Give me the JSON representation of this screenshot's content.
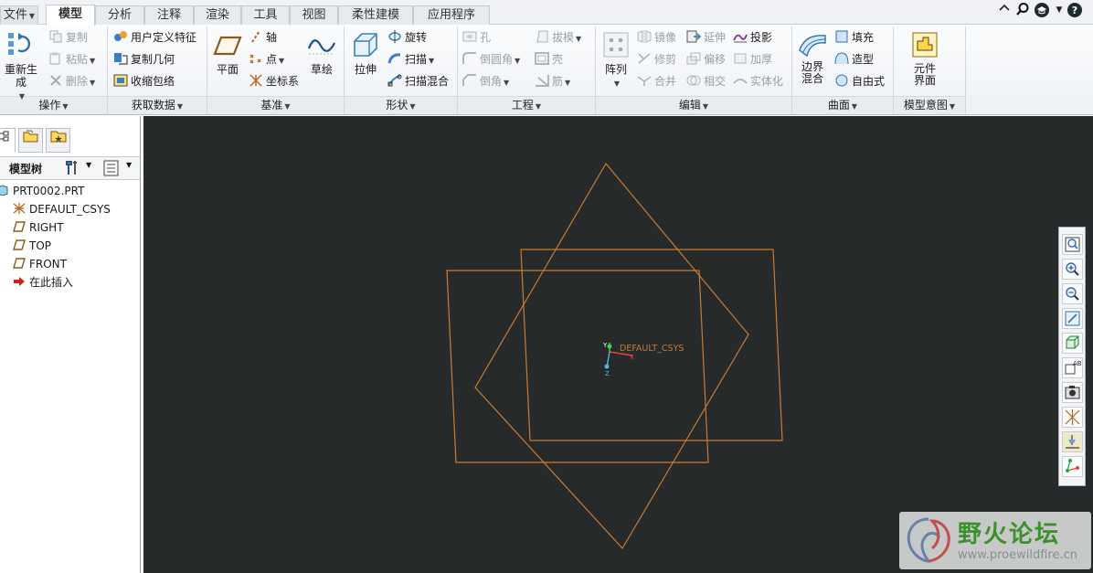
{
  "tabs": {
    "file": "文件",
    "items": [
      "模型",
      "分析",
      "注释",
      "渲染",
      "工具",
      "视图",
      "柔性建模",
      "应用程序"
    ],
    "active_index": 0
  },
  "ribbon": {
    "groups": {
      "operations": {
        "label": "操作",
        "regenerate": "重新生成",
        "copy": "复制",
        "paste": "粘贴",
        "delete": "删除"
      },
      "get_data": {
        "label": "获取数据",
        "udf": "用户定义特征",
        "copy_geom": "复制几何",
        "shrinkwrap": "收缩包络"
      },
      "datum": {
        "label": "基准",
        "plane": "平面",
        "axis": "轴",
        "point": "点",
        "csys": "坐标系",
        "sketch": "草绘"
      },
      "shapes": {
        "label": "形状",
        "extrude": "拉伸",
        "revolve": "旋转",
        "sweep": "扫描",
        "swept_blend": "扫描混合"
      },
      "engineering": {
        "label": "工程",
        "hole": "孔",
        "round": "倒圆角",
        "chamfer": "倒角",
        "draft": "拔模",
        "shell": "壳",
        "rib": "筋"
      },
      "editing": {
        "label": "编辑",
        "pattern": "阵列",
        "mirror": "镜像",
        "trim": "修剪",
        "merge": "合并",
        "extend": "延伸",
        "offset": "偏移",
        "intersect": "相交",
        "project": "投影",
        "thicken": "加厚",
        "solidify": "实体化"
      },
      "surfaces": {
        "label": "曲面",
        "boundary_blend": "边界混合",
        "fill": "填充",
        "style": "造型",
        "freestyle": "自由式"
      },
      "model_intent": {
        "label": "模型意图",
        "component_interface": "元件界面"
      }
    }
  },
  "left_panel": {
    "tree_title": "模型树",
    "items": [
      {
        "label": "PRT0002.PRT",
        "icon": "part-icon"
      },
      {
        "label": "DEFAULT_CSYS",
        "icon": "csys-icon"
      },
      {
        "label": "RIGHT",
        "icon": "datum-plane-icon"
      },
      {
        "label": "TOP",
        "icon": "datum-plane-icon"
      },
      {
        "label": "FRONT",
        "icon": "datum-plane-icon"
      },
      {
        "label": "在此插入",
        "icon": "insert-here-arrow-icon"
      }
    ]
  },
  "viewport": {
    "background": "#262a2b",
    "datum_color": "#c87a33",
    "csys_label": "DEFAULT_CSYS",
    "axis_labels": {
      "x": "X",
      "y": "Y",
      "z": "Z"
    }
  },
  "view_toolbar": {
    "buttons": [
      "refit-icon",
      "zoom-in-icon",
      "zoom-out-icon",
      "repaint-icon",
      "saved-orientations-icon",
      "view-manager-icon",
      "display-style-icon",
      "datum-display-icon",
      "spin-center-icon",
      "annotation-display-icon",
      "csys-display-icon"
    ]
  },
  "watermark": {
    "title": "野火论坛",
    "url": "www.proewildfire.cn"
  }
}
